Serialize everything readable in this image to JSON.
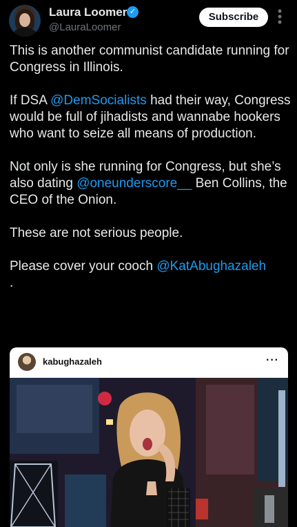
{
  "header": {
    "display_name": "Laura Loomer",
    "handle": "@LauraLoomer",
    "subscribe_label": "Subscribe",
    "verified_glyph": "✓",
    "more_glyph": "⋮"
  },
  "tweet": {
    "p1": "This is another communist candidate running for Congress in Illinois.",
    "p2_a": "If DSA ",
    "p2_mention": "@DemSocialists",
    "p2_b": " had their way, Congress would be full of jihadists and wannabe hookers who want to seize all means of production.",
    "p3_a": "Not only is she running for Congress, but she’s also dating ",
    "p3_mention": "@oneunderscore__",
    "p3_b": " Ben Collins, the CEO of the Onion.",
    "p4": "These are not serious people.",
    "p5_a": "Please cover your cooch ",
    "p5_mention": "@KatAbughazaleh",
    "p5_b": "."
  },
  "embed": {
    "username": "kabughazaleh",
    "more_glyph": "···"
  },
  "colors": {
    "background": "#000000",
    "text": "#e7e9ea",
    "mention": "#1d9bf0",
    "muted": "#71767b"
  },
  "icons": [
    "verified-badge-icon",
    "more-vertical-icon",
    "more-horizontal-icon"
  ]
}
